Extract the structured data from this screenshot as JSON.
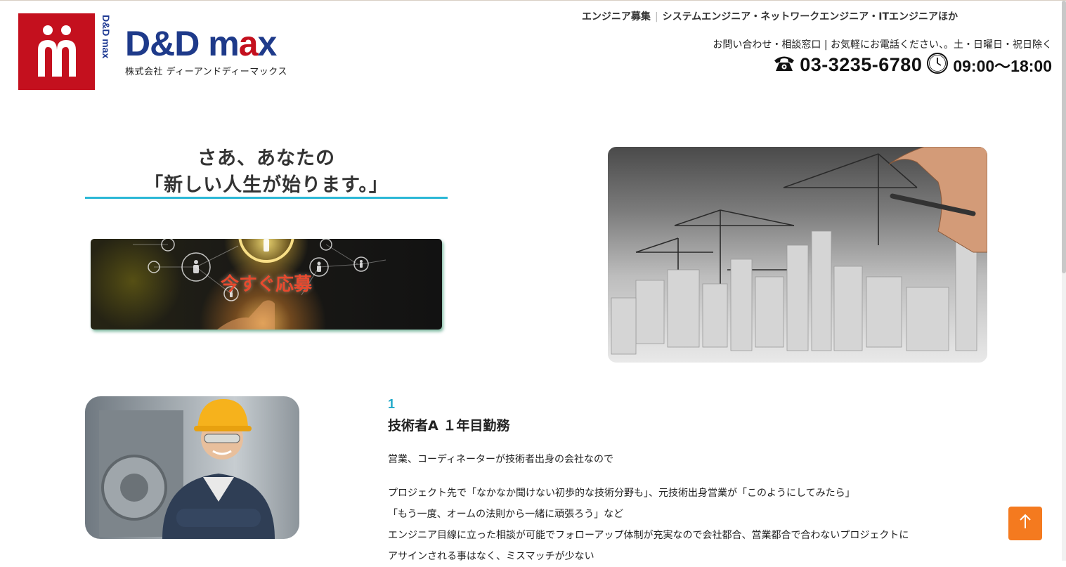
{
  "logo": {
    "vertical_text": "D&D max",
    "name_part1": "D&D m",
    "name_part2": "a",
    "name_part3": "x",
    "subtitle": "株式会社 ディーアンドディーマックス"
  },
  "header": {
    "recruit_label": "エンジニア募集",
    "recruit_roles": "システムエンジニア・ネットワークエンジニア・ITエンジニアほか",
    "contact_text": "お問い合わせ・相談窓口 | お気軽にお電話ください、。土・日曜日・祝日除く",
    "phone": "03-3235-6780",
    "hours": "09:00〜18:00"
  },
  "hero": {
    "title_line1": "さあ、あなたの",
    "title_line2": "「新しい人生が始ります。」",
    "apply_label": "今すぐ応募"
  },
  "entries": [
    {
      "number": "1",
      "title": "技術者A １年目勤務",
      "body": [
        "営業、コーディネーターが技術者出身の会社なので",
        "プロジェクト先で「なかなか聞けない初歩的な技術分野も」、元技術出身営業が「このようにしてみたら」",
        "「もう一度、オームの法則から一緒に頑張ろう」など",
        "エンジニア目線に立った相談が可能でフォローアップ体制が充実なので会社都合、営業都合で合わないプロジェクトに",
        "アサインされる事はなく、ミスマッチが少ない"
      ]
    }
  ],
  "to_top_icon": "arrow-up-icon",
  "colors": {
    "brand_red": "#c4101e",
    "brand_blue": "#1e3a8a",
    "accent_cyan": "#2bb7d6",
    "to_top": "#f47a1f"
  }
}
